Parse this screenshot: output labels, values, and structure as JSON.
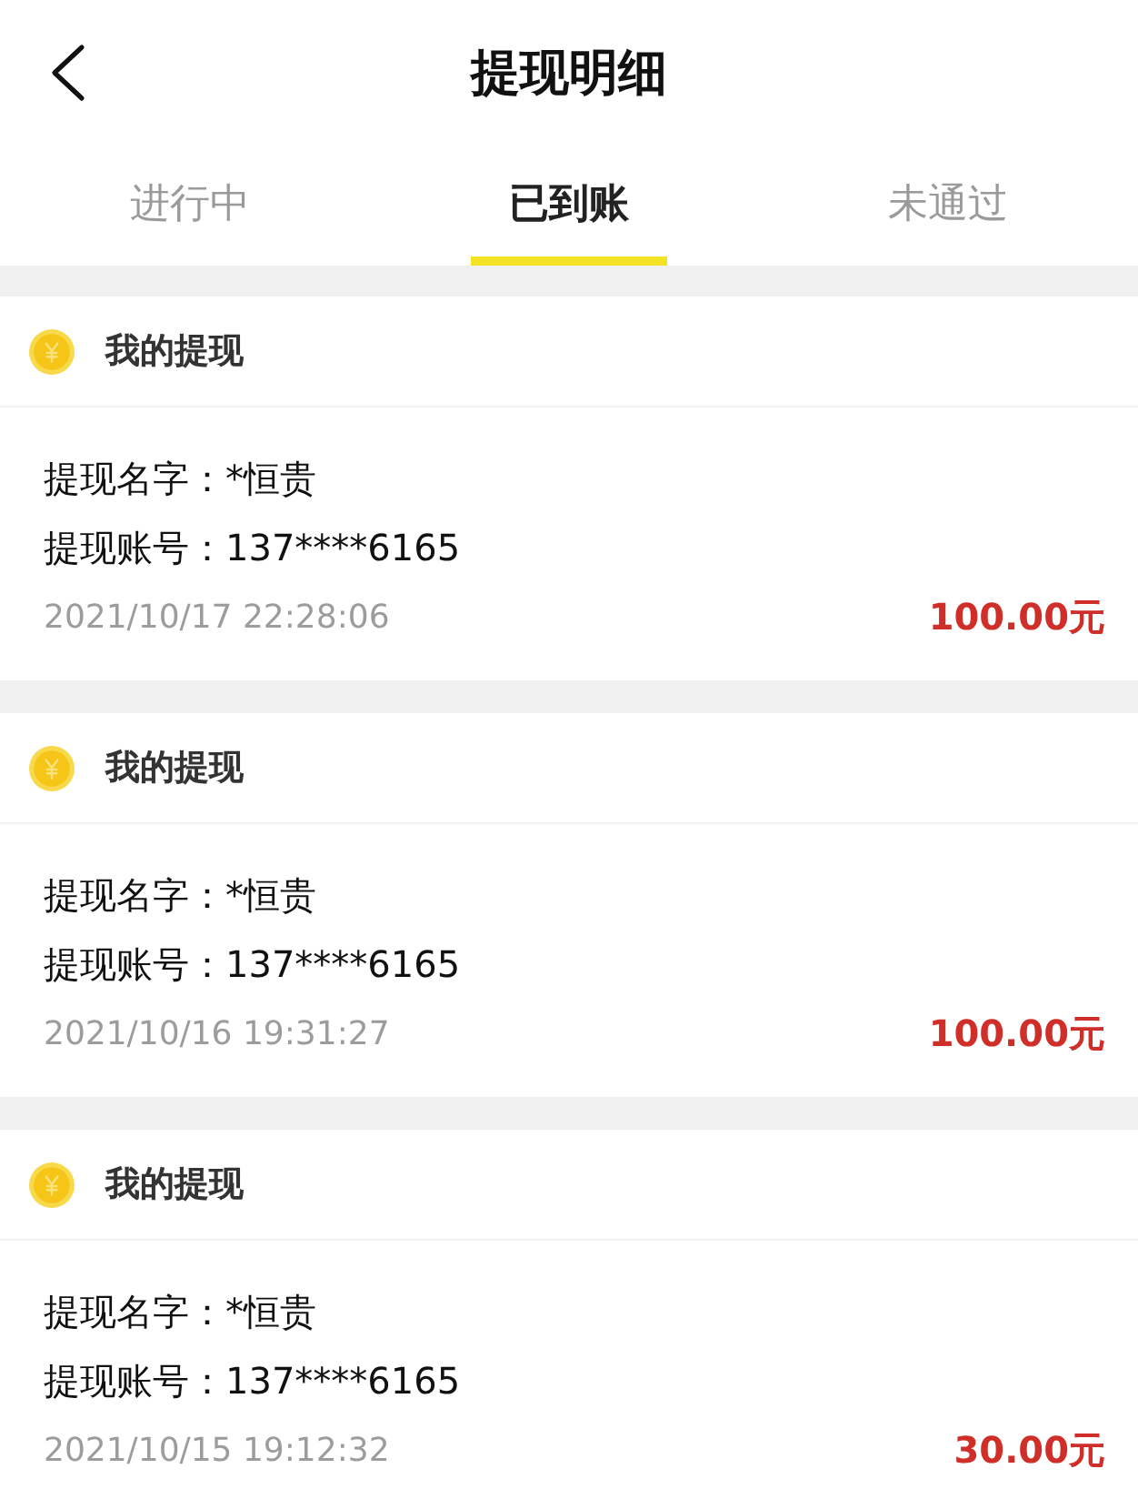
{
  "header": {
    "title": "提现明细"
  },
  "tabs": [
    {
      "label": "进行中",
      "selected": false
    },
    {
      "label": "已到账",
      "selected": true
    },
    {
      "label": "未通过",
      "selected": false
    }
  ],
  "records": [
    {
      "title": "我的提现",
      "name_line": "提现名字：*恒贵",
      "account_line": "提现账号：137****6165",
      "time": "2021/10/17 22:28:06",
      "amount": "100.00元"
    },
    {
      "title": "我的提现",
      "name_line": "提现名字：*恒贵",
      "account_line": "提现账号：137****6165",
      "time": "2021/10/16 19:31:27",
      "amount": "100.00元"
    },
    {
      "title": "我的提现",
      "name_line": "提现名字：*恒贵",
      "account_line": "提现账号：137****6165",
      "time": "2021/10/15 19:12:32",
      "amount": "30.00元"
    }
  ]
}
